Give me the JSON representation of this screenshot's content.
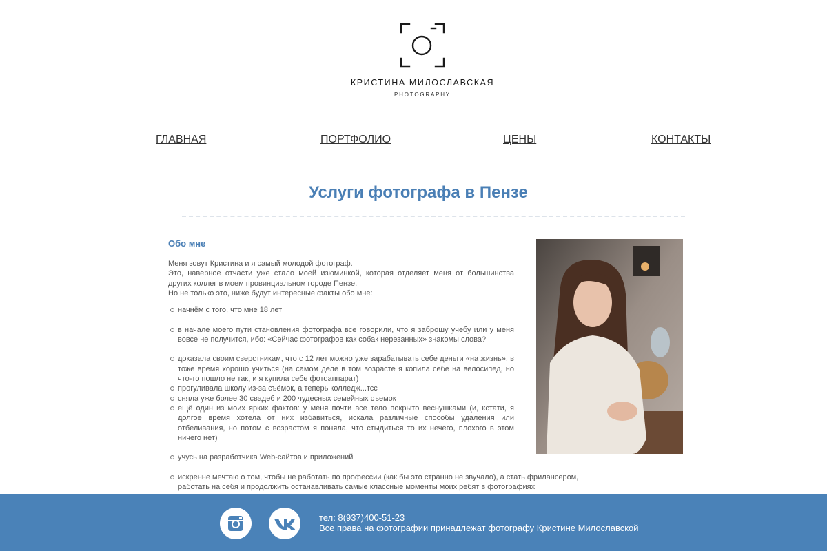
{
  "brand": {
    "name": "КРИСТИНА МИЛОСЛАВСКАЯ",
    "subtitle": "PHOTOGRAPHY"
  },
  "nav": {
    "items": [
      {
        "label": "ГЛАВНАЯ"
      },
      {
        "label": "ПОРТФОЛИО"
      },
      {
        "label": "ЦЕНЫ"
      },
      {
        "label": "КОНТАКТЫ"
      }
    ]
  },
  "main": {
    "title": "Услуги фотографа в Пензе",
    "about": {
      "heading": "Обо мне",
      "intro": [
        "Меня зовут Кристина и я самый молодой фотограф.",
        "Это, наверное отчасти уже стало моей изюминкой, которая отделяет меня от большинства других коллег в моем провинциальном городе Пензе.",
        "Но не только это, ниже будут интересные факты обо мне:"
      ],
      "facts": [
        "начнём с того, что мне 18 лет",
        "в начале моего пути становления фотографа все говорили, что я заброшу учебу или у меня вовсе не получится, ибо: «Сейчас фотографов как собак нерезанных» знакомы слова?",
        "доказала своим сверстникам, что с 12 лет можно уже зарабатывать себе деньги «на жизнь», в тоже время хорошо учиться (на самом деле в том возрасте я копила себе на велосипед, но что-то пошло не так, и я купила себе фотоаппарат)",
        "прогуливала школу из-за съёмок, а теперь колледж...тсс",
        "сняла уже более 30 свадеб и 200 чудесных семейных съемок",
        "ещё один из моих ярких фактов: у меня почти все тело покрыто веснушками (и, кстати, я долгое время хотела от них избавиться, искала различные способы удаления или отбеливания, но потом с возрастом я поняла, что стыдиться то их нечего, плохого в этом ничего нет)",
        "учусь на разработчика Web-сайтов и приложений",
        "искренне мечтаю о том, чтобы не работать по профессии (как бы это странно не звучало), а стать фрилансером, работать на себя и продолжить останавливать самые классные моменты моих ребят в фотографиях"
      ]
    }
  },
  "footer": {
    "phone": "тел: 8(937)400-51-23",
    "rights": "Все права на фотографии принадлежат фотографу Кристине Милославской",
    "social": [
      {
        "icon": "instagram-icon"
      },
      {
        "icon": "vk-icon"
      }
    ]
  },
  "colors": {
    "accent": "#4a7fb5",
    "footer_bg": "#4a82b8",
    "text": "#555555"
  }
}
